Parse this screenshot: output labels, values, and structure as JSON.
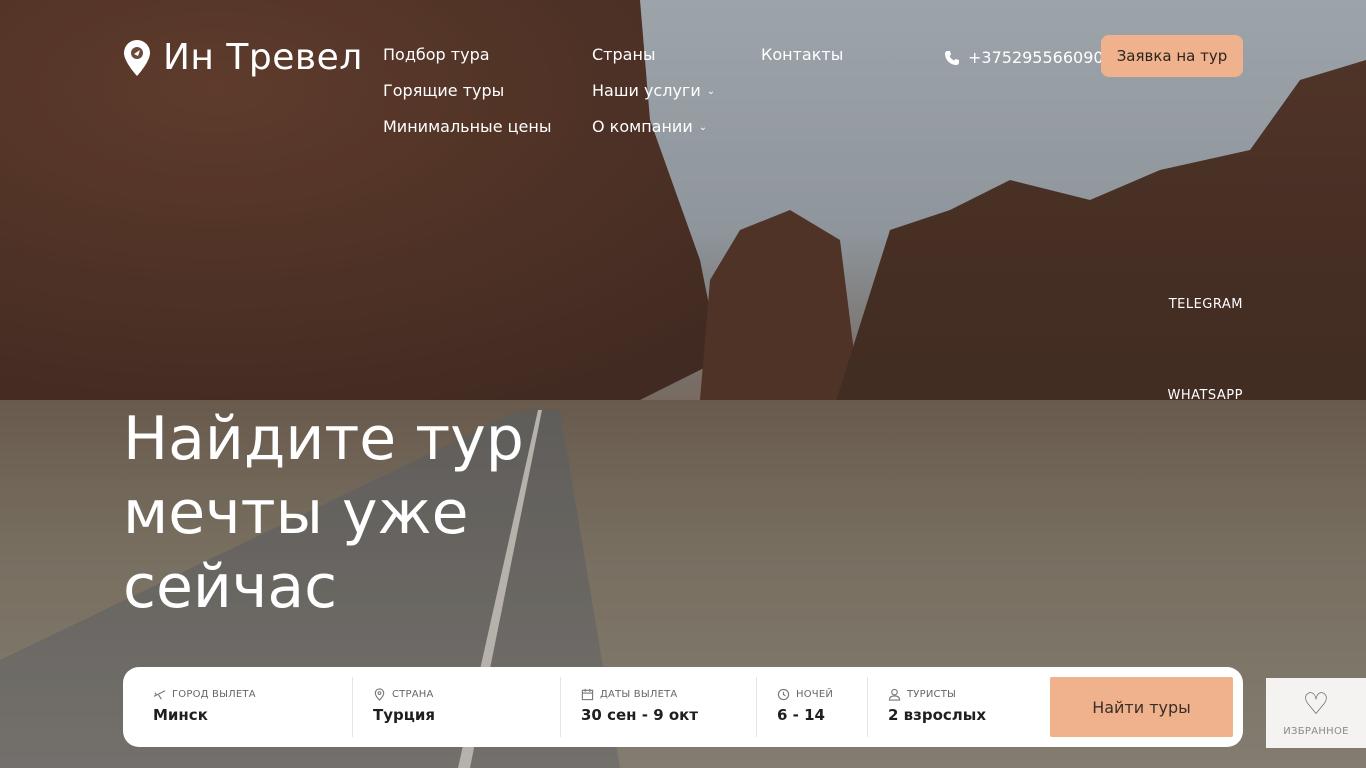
{
  "brand": {
    "name": "Ин Тревел"
  },
  "nav": {
    "col1": [
      "Подбор тура",
      "Горящие туры",
      "Минимальные цены"
    ],
    "col2": [
      "Страны",
      "Наши услуги",
      "О компании"
    ],
    "col3": [
      "Контакты"
    ]
  },
  "header": {
    "phone": "+375295566090",
    "cta_label": "Заявка на тур"
  },
  "social": {
    "telegram": "TELEGRAM",
    "whatsapp": "WHATSAPP"
  },
  "hero": {
    "title_line1": "Найдите тур",
    "title_line2": "мечты уже",
    "title_line3": "сейчас"
  },
  "search": {
    "departure": {
      "label": "Город вылета",
      "value": "Минск"
    },
    "country": {
      "label": "Страна",
      "value": "Турция"
    },
    "dates": {
      "label": "Даты вылета",
      "value": "30 сен - 9 окт"
    },
    "nights": {
      "label": "Ночей",
      "value": "6 - 14"
    },
    "tourists": {
      "label": "Туристы",
      "value": "2 взрослых"
    },
    "submit_label": "Найти туры"
  },
  "favorites": {
    "label": "ИЗБРАННОЕ"
  },
  "colors": {
    "accent": "#f0b28c",
    "panel": "#ffffff"
  }
}
